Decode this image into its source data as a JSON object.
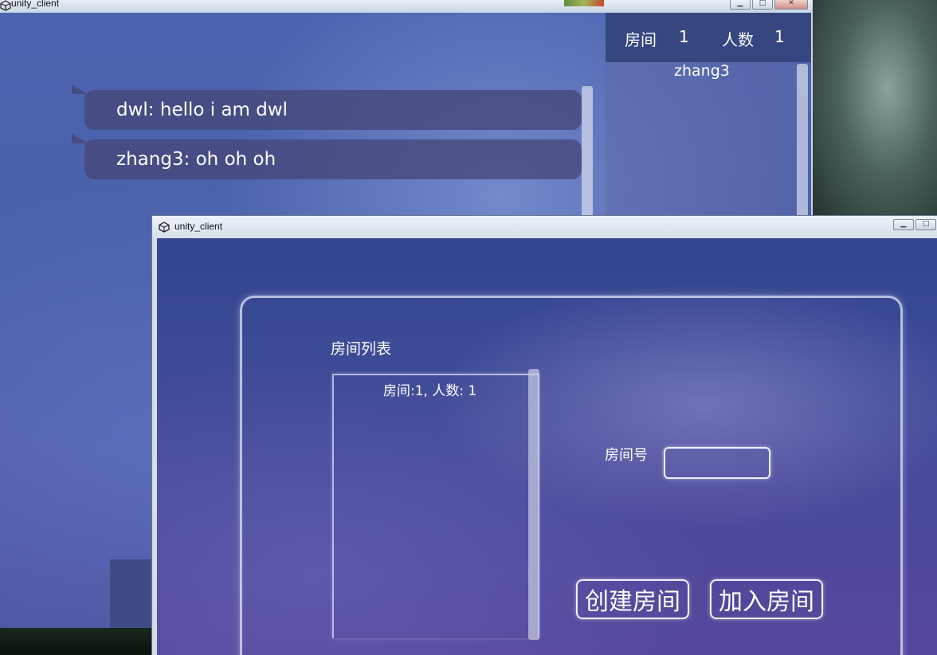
{
  "window_back": {
    "title": "unity_client",
    "controls": {
      "minimize": "▁",
      "maximize": "□",
      "close": "✕"
    },
    "chat": {
      "messages": [
        "dwl: hello i am dwl",
        "zhang3: oh oh oh"
      ]
    },
    "room_info": {
      "room_label": "房间",
      "room_value": "1",
      "count_label": "人数",
      "count_value": "1"
    },
    "members": [
      "zhang3"
    ]
  },
  "window_front": {
    "title": "unity_client",
    "controls": {
      "minimize": "▁",
      "maximize": "□"
    },
    "room_list_title": "房间列表",
    "rooms": [
      "房间:1, 人数: 1"
    ],
    "room_number_label": "房间号",
    "room_number_value": "",
    "create_button": "创建房间",
    "join_button": "加入房间"
  }
}
